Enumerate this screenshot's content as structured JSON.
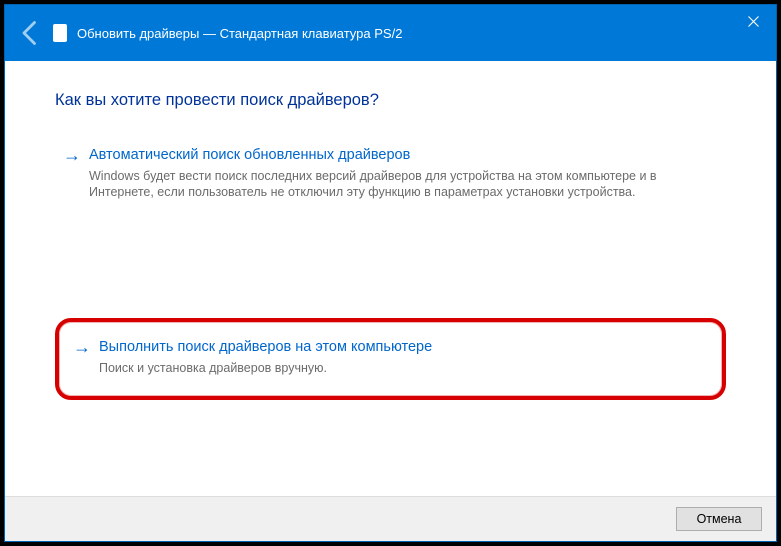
{
  "titlebar": {
    "title": "Обновить драйверы — Стандартная клавиатура PS/2"
  },
  "content": {
    "heading": "Как вы хотите провести поиск драйверов?",
    "option_auto": {
      "title": "Автоматический поиск обновленных драйверов",
      "desc": "Windows будет вести поиск последних версий драйверов для устройства на этом компьютере и в Интернете, если пользователь не отключил эту функцию в параметрах установки устройства."
    },
    "option_manual": {
      "title": "Выполнить поиск драйверов на этом компьютере",
      "desc": "Поиск и установка драйверов вручную."
    }
  },
  "footer": {
    "cancel": "Отмена"
  }
}
